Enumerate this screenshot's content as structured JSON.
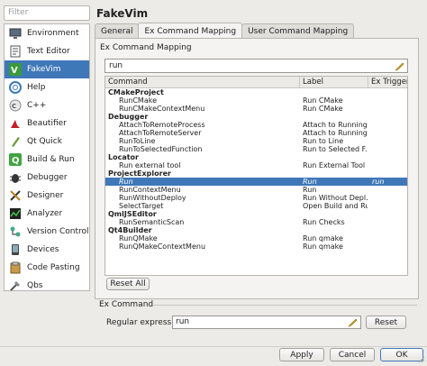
{
  "colors": {
    "selection": "#3f78b8",
    "panel": "#f4f3f1",
    "window": "#ecebe8"
  },
  "filter": {
    "placeholder": "Filter"
  },
  "sidebar": {
    "items": [
      {
        "label": "Environment",
        "icon": "monitor-icon"
      },
      {
        "label": "Text Editor",
        "icon": "text-editor-icon"
      },
      {
        "label": "FakeVim",
        "icon": "fakevim-icon",
        "selected": true
      },
      {
        "label": "Help",
        "icon": "help-icon"
      },
      {
        "label": "C++",
        "icon": "cpp-icon"
      },
      {
        "label": "Beautifier",
        "icon": "beautifier-icon"
      },
      {
        "label": "Qt Quick",
        "icon": "qt-quick-icon"
      },
      {
        "label": "Build & Run",
        "icon": "build-run-icon"
      },
      {
        "label": "Debugger",
        "icon": "debugger-icon"
      },
      {
        "label": "Designer",
        "icon": "designer-icon"
      },
      {
        "label": "Analyzer",
        "icon": "analyzer-icon"
      },
      {
        "label": "Version Control",
        "icon": "version-control-icon"
      },
      {
        "label": "Devices",
        "icon": "devices-icon"
      },
      {
        "label": "Code Pasting",
        "icon": "code-pasting-icon"
      },
      {
        "label": "Qbs",
        "icon": "qbs-icon"
      }
    ]
  },
  "page": {
    "title": "FakeVim"
  },
  "tabs": [
    {
      "label": "General"
    },
    {
      "label": "Ex Command Mapping",
      "active": true
    },
    {
      "label": "User Command Mapping"
    }
  ],
  "mapping": {
    "group_title": "Ex Command Mapping",
    "search_value": "run",
    "columns": [
      "Command",
      "Label",
      "Ex Trigger Ex"
    ],
    "rows": [
      {
        "c1": "CMakeProject",
        "category": true
      },
      {
        "c1": "RunCMake",
        "c2": "Run CMake"
      },
      {
        "c1": "RunCMakeContextMenu",
        "c2": "Run CMake"
      },
      {
        "c1": "Debugger",
        "category": true
      },
      {
        "c1": "AttachToRemoteProcess",
        "c2": "Attach to Running..."
      },
      {
        "c1": "AttachToRemoteServer",
        "c2": "Attach to Running..."
      },
      {
        "c1": "RunToLine",
        "c2": "Run to Line"
      },
      {
        "c1": "RunToSelectedFunction",
        "c2": "Run to Selected F..."
      },
      {
        "c1": "Locator",
        "category": true
      },
      {
        "c1": "Run external tool",
        "c2": "Run External Tool"
      },
      {
        "c1": "ProjectExplorer",
        "category": true
      },
      {
        "c1": "Run",
        "c2": "Run",
        "c3": "run",
        "selected": true
      },
      {
        "c1": "RunContextMenu",
        "c2": "Run"
      },
      {
        "c1": "RunWithoutDeploy",
        "c2": "Run Without Depl..."
      },
      {
        "c1": "SelectTarget",
        "c2": "Open Build and Ru..."
      },
      {
        "c1": "QmlJSEditor",
        "category": true
      },
      {
        "c1": "RunSemanticScan",
        "c2": "Run Checks"
      },
      {
        "c1": "Qt4Builder",
        "category": true
      },
      {
        "c1": "RunQMake",
        "c2": "Run qmake"
      },
      {
        "c1": "RunQMakeContextMenu",
        "c2": "Run qmake"
      }
    ],
    "reset_all_label": "Reset All"
  },
  "ex_command": {
    "group_title": "Ex Command",
    "regex_label": "Regular expression:",
    "regex_value": "run",
    "reset_label": "Reset"
  },
  "footer": {
    "apply_label": "Apply",
    "cancel_label": "Cancel",
    "ok_label": "OK"
  }
}
